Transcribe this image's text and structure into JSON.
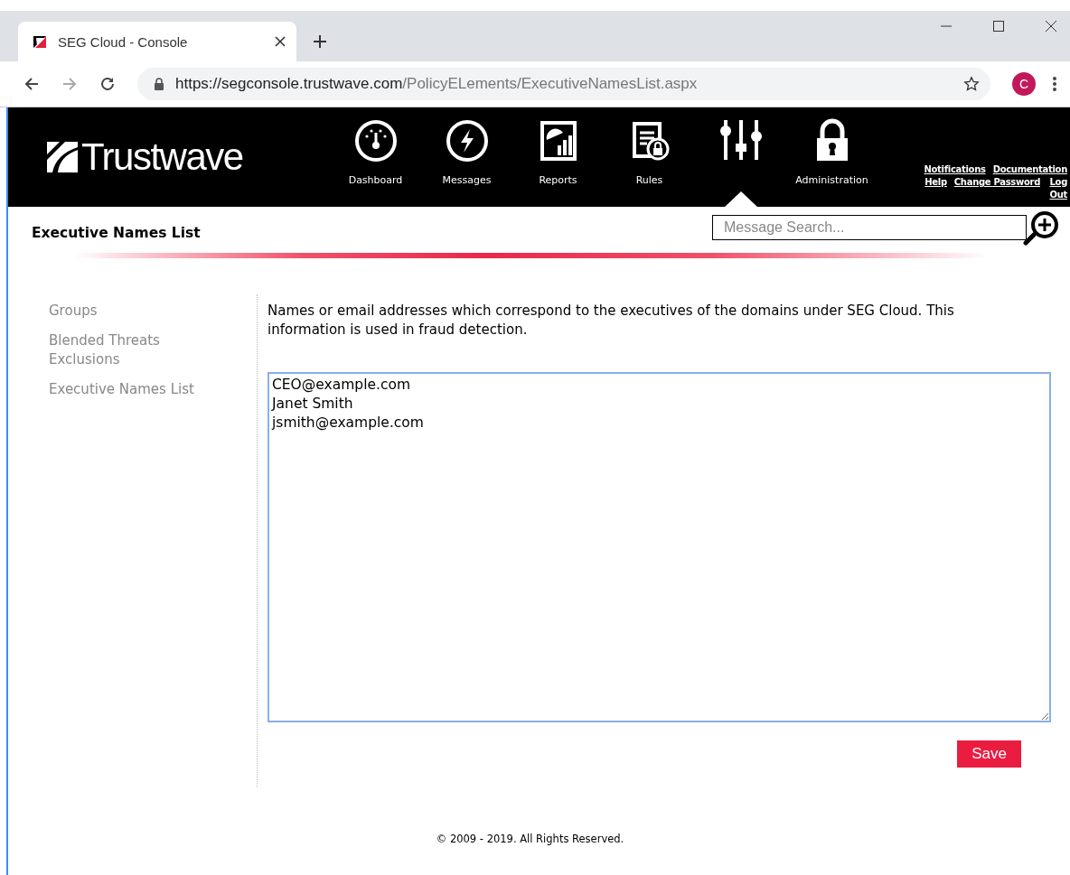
{
  "browser": {
    "tab_title": "SEG Cloud - Console",
    "url_host": "https://segconsole.trustwave.com",
    "url_path": "/PolicyELements/ExecutiveNamesList.aspx",
    "profile_initial": "C"
  },
  "header": {
    "logo": "Trustwave",
    "nav": [
      {
        "kind": "dashboard",
        "label": "Dashboard",
        "selected": false
      },
      {
        "kind": "messages",
        "label": "Messages",
        "selected": false
      },
      {
        "kind": "reports",
        "label": "Reports",
        "selected": false
      },
      {
        "kind": "rules",
        "label": "Rules",
        "selected": false
      },
      {
        "kind": "policy",
        "selected": true
      },
      {
        "kind": "administration",
        "label": "Administration",
        "selected": false
      }
    ],
    "links": [
      [
        "Notifications",
        "Documentation"
      ],
      [
        "Help",
        "Change Password",
        "Log Out"
      ]
    ]
  },
  "page_title": "Executive Names List",
  "search": {
    "placeholder": "Message Search..."
  },
  "sidebar": {
    "items": [
      "Groups",
      "Blended Threats Exclusions",
      "Executive Names List"
    ]
  },
  "description": "Names or email addresses which correspond to the executives of the domains under SEG Cloud. This information is used in fraud detection.",
  "names_field": {
    "value": "CEO@example.com\nJanet Smith\njsmith@example.com"
  },
  "save_button": "Save",
  "footer": "© 2009 - 2019. All Rights Reserved."
}
